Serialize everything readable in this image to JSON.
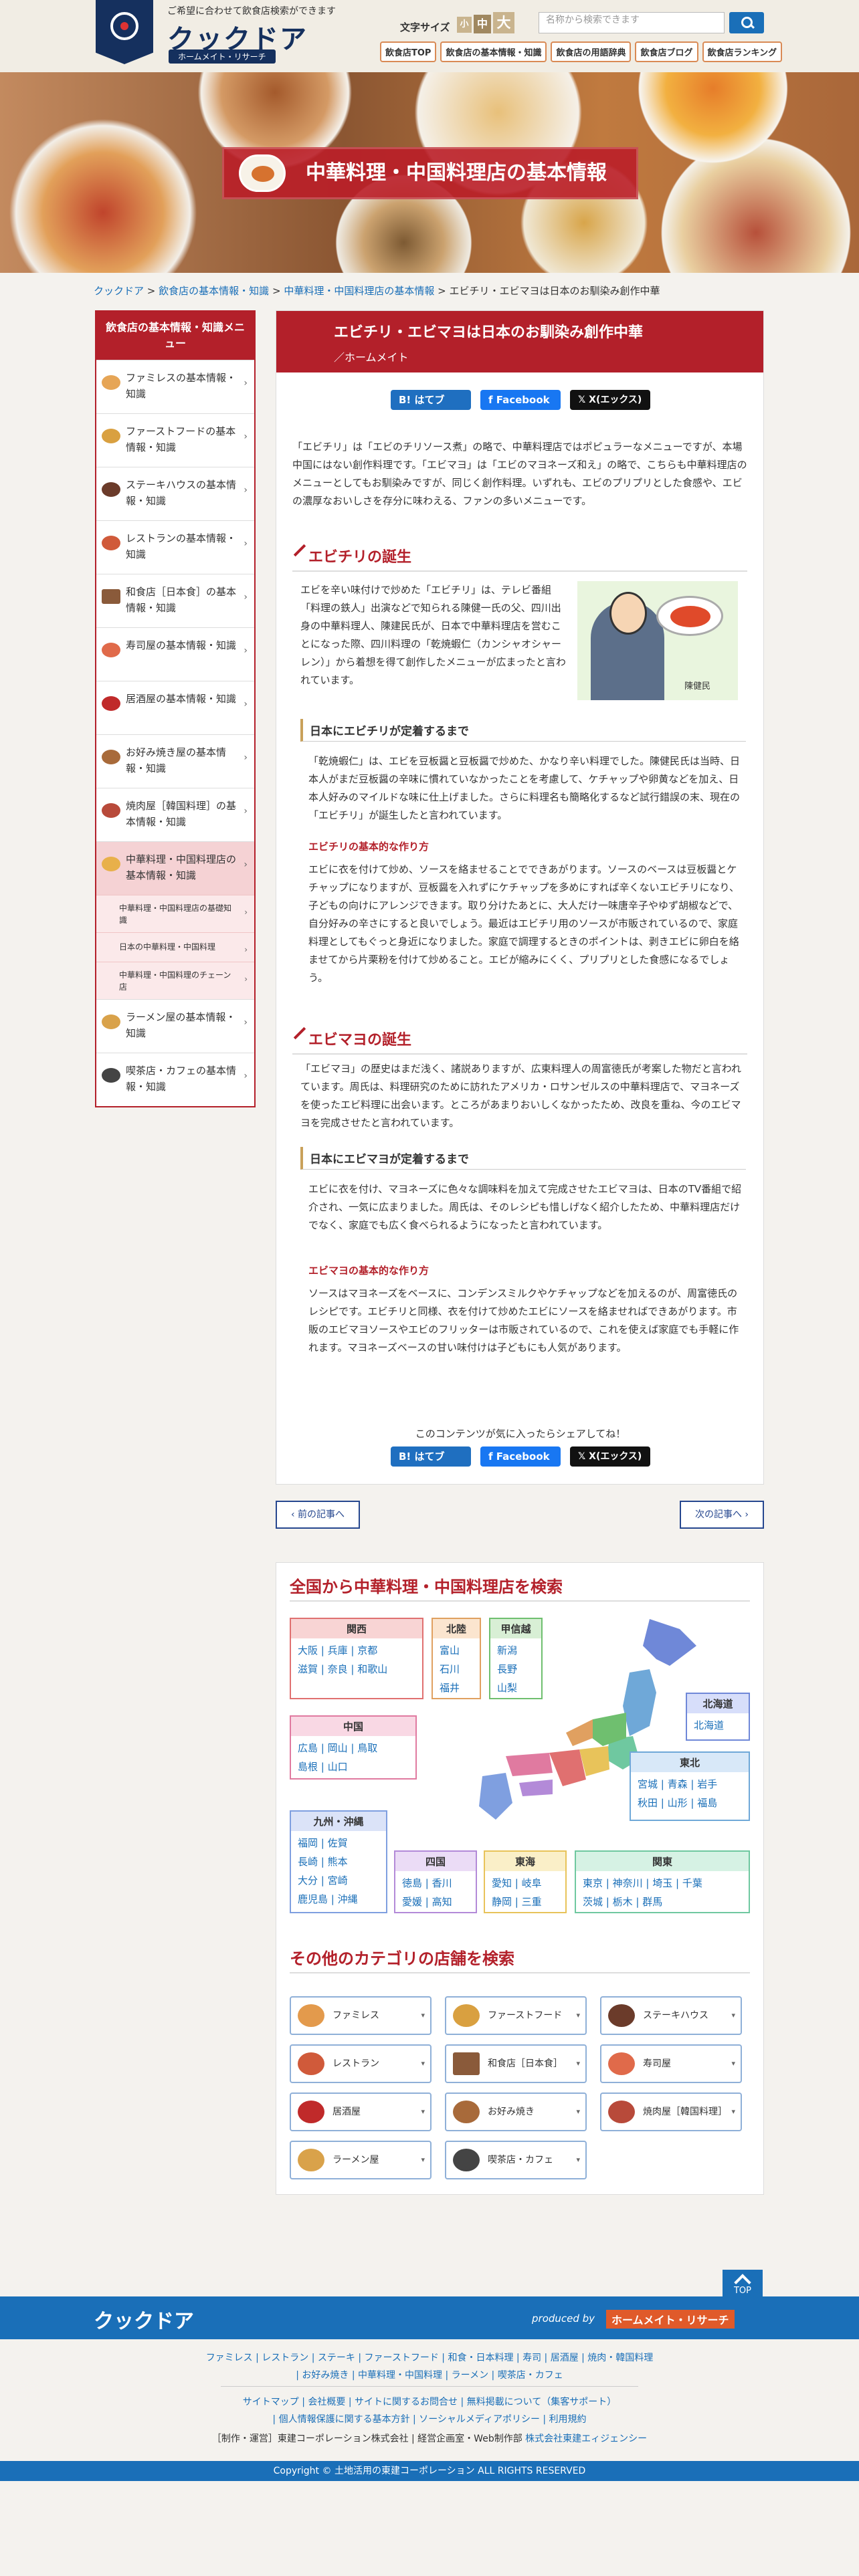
{
  "header": {
    "tagline": "ご希望に合わせて飲食店検索ができます",
    "logo": "クックドア",
    "logo_sub": "ホームメイト・リサーチ",
    "font_size_label": "文字サイズ",
    "font_sizes": [
      "小",
      "中",
      "大"
    ],
    "search_placeholder": "名称から検索できます",
    "nav": [
      "飲食店TOP",
      "飲食店の基本情報・知識",
      "飲食店の用語辞典",
      "飲食店ブログ",
      "飲食店ランキング"
    ]
  },
  "hero": {
    "title": "中華料理・中国料理店の基本情報"
  },
  "breadcrumb": [
    "クックドア",
    "飲食店の基本情報・知識",
    "中華料理・中国料理店の基本情報",
    "エビチリ・エビマヨは日本のお馴染み創作中華"
  ],
  "breadcrumb_sep": ">",
  "sidebar": {
    "title": "飲食店の基本情報・知識メニュー",
    "items": [
      {
        "label": "ファミレスの基本情報・知識"
      },
      {
        "label": "ファーストフードの基本情報・知識"
      },
      {
        "label": "ステーキハウスの基本情報・知識"
      },
      {
        "label": "レストランの基本情報・知識"
      },
      {
        "label": "和食店［日本食］の基本情報・知識"
      },
      {
        "label": "寿司屋の基本情報・知識"
      },
      {
        "label": "居酒屋の基本情報・知識"
      },
      {
        "label": "お好み焼き屋の基本情報・知識"
      },
      {
        "label": "焼肉屋［韓国料理］の基本情報・知識"
      },
      {
        "label": "中華料理・中国料理店の基本情報・知識"
      },
      {
        "label": "ラーメン屋の基本情報・知識"
      },
      {
        "label": "喫茶店・カフェの基本情報・知識"
      }
    ],
    "subitems": [
      "中華料理・中国料理店の基礎知識",
      "日本の中華料理・中国料理",
      "中華料理・中国料理のチェーン店"
    ]
  },
  "article": {
    "title": "エビチリ・エビマヨは日本のお馴染み創作中華",
    "author": "／ホームメイト",
    "share": {
      "hatena": "はてブ",
      "facebook": "Facebook",
      "x": "X(エックス)"
    },
    "intro": "「エビチリ」は「エビのチリソース煮」の略で、中華料理店ではポピュラーなメニューですが、本場中国にはない創作料理です。「エビマヨ」は「エビのマヨネーズ和え」の略で、こちらも中華料理店のメニューとしてもお馴染みですが、同じく創作料理。いずれも、エビのプリプリとした食感や、エビの濃厚なおいしさを存分に味わえる、ファンの多いメニューです。",
    "h2_1": "エビチリの誕生",
    "p1": "エビを辛い味付けで炒めた「エビチリ」は、テレビ番組「料理の鉄人」出演などで知られる陳健一氏の父、四川出身の中華料理人、陳建民氏が、日本で中華料理店を営むことになった際、四川料理の「乾焼蝦仁（カンシャオシャーレン）」から着想を得て創作したメニューが広まったと言われています。",
    "illus_caption": "陳健民",
    "h3_1": "日本にエビチリが定着するまで",
    "p2": "「乾焼蝦仁」は、エビを豆板醤と豆板醤で炒めた、かなり辛い料理でした。陳健民氏は当時、日本人がまだ豆板醤の辛味に慣れていなかったことを考慮して、ケチャップや卵黄などを加え、日本人好みのマイルドな味に仕上げました。さらに料理名も簡略化するなど試行錯誤の末、現在の「エビチリ」が誕生したと言われています。",
    "h4_1": "エビチリの基本的な作り方",
    "p3": "エビに衣を付けて炒め、ソースを絡ませることでできあがります。ソースのベースは豆板醤とケチャップになりますが、豆板醤を入れずにケチャップを多めにすれば辛くないエビチリになり、子どもの向けにアレンジできます。取り分けたあとに、大人だけ一味唐辛子やゆず胡椒などで、自分好みの辛さにすると良いでしょう。最近はエビチリ用のソースが市販されているので、家庭料理としてもぐっと身近になりました。家庭で調理するときのポイントは、剥きエビに卵白を絡ませてから片栗粉を付けて炒めること。エビが縮みにくく、プリプリとした食感になるでしょう。",
    "h2_2": "エビマヨの誕生",
    "p4": "「エビマヨ」の歴史はまだ浅く、諸説ありますが、広東料理人の周富徳氏が考案した物だと言われています。周氏は、料理研究のために訪れたアメリカ・ロサンゼルスの中華料理店で、マヨネーズを使ったエビ料理に出会います。ところがあまりおいしくなかったため、改良を重ね、今のエビマヨを完成させたと言われています。",
    "h3_2": "日本にエビマヨが定着するまで",
    "p5": "エビに衣を付け、マヨネーズに色々な調味料を加えて完成させたエビマヨは、日本のTV番組で紹介され、一気に広まりました。周氏は、そのレシピも惜しげなく紹介したため、中華料理店だけでなく、家庭でも広く食べられるようになったと言われています。",
    "h4_2": "エビマヨの基本的な作り方",
    "p6": "ソースはマヨネーズをベースに、コンデンスミルクやケチャップなどを加えるのが、周富徳氏のレシピです。エビチリと同様、衣を付けて炒めたエビにソースを絡ませればできあがります。市販のエビマヨソースやエビのフリッターは市販されているので、これを使えば家庭でも手軽に作れます。マヨネーズベースの甘い味付けは子どもにも人気があります。",
    "share_prompt": "このコンテンツが気に入ったらシェアしてね！"
  },
  "pager": {
    "prev": "前の記事へ",
    "next": "次の記事へ"
  },
  "area": {
    "title": "全国から中華料理・中国料理店を検索",
    "regions": [
      {
        "name": "関西",
        "prefs": [
          "大阪",
          "兵庫",
          "京都",
          "滋賀",
          "奈良",
          "和歌山"
        ]
      },
      {
        "name": "北陸",
        "prefs": [
          "富山",
          "石川",
          "福井"
        ]
      },
      {
        "name": "甲信越",
        "prefs": [
          "新潟",
          "長野",
          "山梨"
        ]
      },
      {
        "name": "北海道",
        "prefs": [
          "北海道"
        ]
      },
      {
        "name": "中国",
        "prefs": [
          "広島",
          "岡山",
          "鳥取",
          "島根",
          "山口"
        ]
      },
      {
        "name": "東北",
        "prefs": [
          "宮城",
          "青森",
          "岩手",
          "秋田",
          "山形",
          "福島"
        ]
      },
      {
        "name": "九州・沖縄",
        "prefs": [
          "福岡",
          "佐賀",
          "長崎",
          "熊本",
          "大分",
          "宮崎",
          "鹿児島",
          "沖縄"
        ]
      },
      {
        "name": "四国",
        "prefs": [
          "徳島",
          "香川",
          "愛媛",
          "高知"
        ]
      },
      {
        "name": "東海",
        "prefs": [
          "愛知",
          "岐阜",
          "静岡",
          "三重"
        ]
      },
      {
        "name": "関東",
        "prefs": [
          "東京",
          "神奈川",
          "埼玉",
          "千葉",
          "茨城",
          "栃木",
          "群馬"
        ]
      }
    ],
    "colors": {
      "関西": "#e07070",
      "北陸": "#e0a060",
      "甲信越": "#6fbf6f",
      "北海道": "#6f88d8",
      "中国": "#e07aa0",
      "東北": "#6fa8d8",
      "九州・沖縄": "#7f9fe0",
      "四国": "#b38ad8",
      "東海": "#e8c35a",
      "関東": "#6fc8a0"
    }
  },
  "categories": {
    "title": "その他のカテゴリの店舗を検索",
    "items": [
      "ファミレス",
      "ファーストフード",
      "ステーキハウス",
      "レストラン",
      "和食店［日本食］",
      "寿司屋",
      "居酒屋",
      "お好み焼き",
      "焼肉屋［韓国料理］",
      "ラーメン屋",
      "喫茶店・カフェ"
    ]
  },
  "footer": {
    "top": "TOP",
    "logo": "クックドア",
    "produced_by": "produced by",
    "brand": "ホームメイト・リサーチ",
    "links1": "ファミレス | レストラン | ステーキ | ファーストフード | 和食・日本料理 | 寿司 | 居酒屋 | 焼肉・韓国料理",
    "links2": "| お好み焼き | 中華料理・中国料理 | ラーメン | 喫茶店・カフェ",
    "links3": "サイトマップ | 会社概要 | サイトに関するお問合せ | 無料掲載について（集客サポート）",
    "links4": "| 個人情報保護に関する基本方針 | ソーシャルメディアポリシー | 利用規約",
    "credit_prefix": "［制作・運営］東建コーポレーション株式会社 | 経営企画室・Web制作部",
    "credit_link": "株式会社東建エィジェンシー",
    "copyright": "Copyright © 土地活用の東建コーポレーション ALL RIGHTS RESERVED"
  }
}
